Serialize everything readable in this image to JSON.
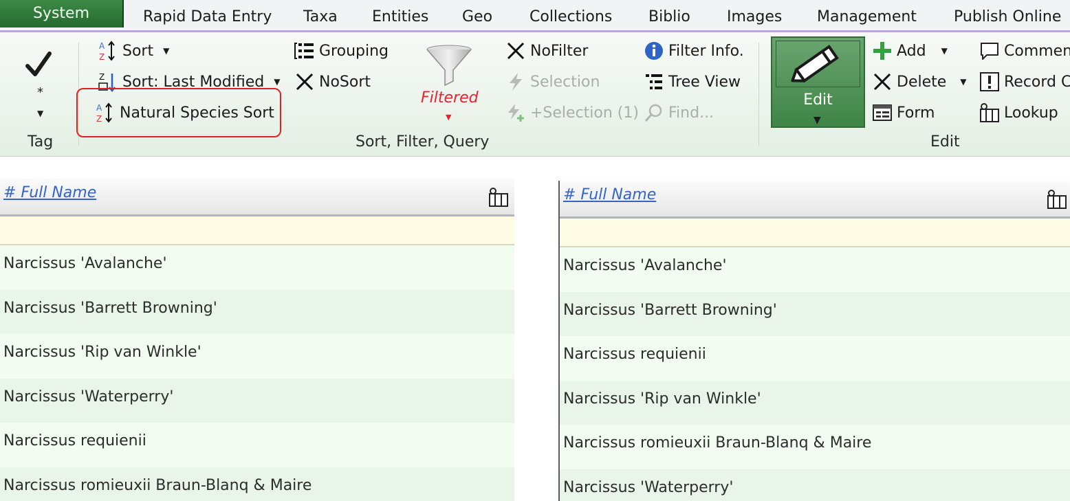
{
  "menu": {
    "items": [
      "System",
      "Rapid Data Entry",
      "Taxa",
      "Entities",
      "Geo",
      "Collections",
      "Biblio",
      "Images",
      "Management",
      "Publish Online"
    ]
  },
  "ribbon": {
    "tag_group": {
      "asterisk": "*",
      "label": "Tag"
    },
    "sort_group": {
      "sort": "Sort",
      "sort_last_modified": "Sort: Last Modified",
      "natural_species_sort": "Natural Species Sort",
      "grouping": "Grouping",
      "nosort": "NoSort",
      "filtered": "Filtered",
      "nofilter": "NoFilter",
      "selection": "Selection",
      "plus_selection": "+Selection (1)",
      "filter_info": "Filter Info.",
      "tree_view": "Tree View",
      "find": "Find...",
      "label": "Sort, Filter, Query"
    },
    "edit_group": {
      "edit": "Edit",
      "add": "Add",
      "delete": "Delete",
      "form": "Form",
      "comment": "Commen",
      "record": "Record C",
      "lookup": "Lookup",
      "label": "Edit"
    }
  },
  "grids": {
    "left": {
      "header": "# Full Name",
      "rows": [
        "Narcissus 'Avalanche'",
        "Narcissus 'Barrett Browning'",
        "Narcissus 'Rip van Winkle'",
        "Narcissus 'Waterperry'",
        "Narcissus requienii",
        "Narcissus romieuxii Braun-Blanq & Maire"
      ]
    },
    "right": {
      "header": "# Full Name",
      "rows": [
        "Narcissus 'Avalanche'",
        "Narcissus 'Barrett Browning'",
        "Narcissus requienii",
        "Narcissus 'Rip van Winkle'",
        "Narcissus romieuxii Braun-Blanq & Maire",
        "Narcissus 'Waterperry'"
      ]
    }
  },
  "colors": {
    "active_tab": "#2f7a38",
    "highlight": "#e02020",
    "filtered_text": "#e8222f",
    "link": "#3464c9"
  }
}
